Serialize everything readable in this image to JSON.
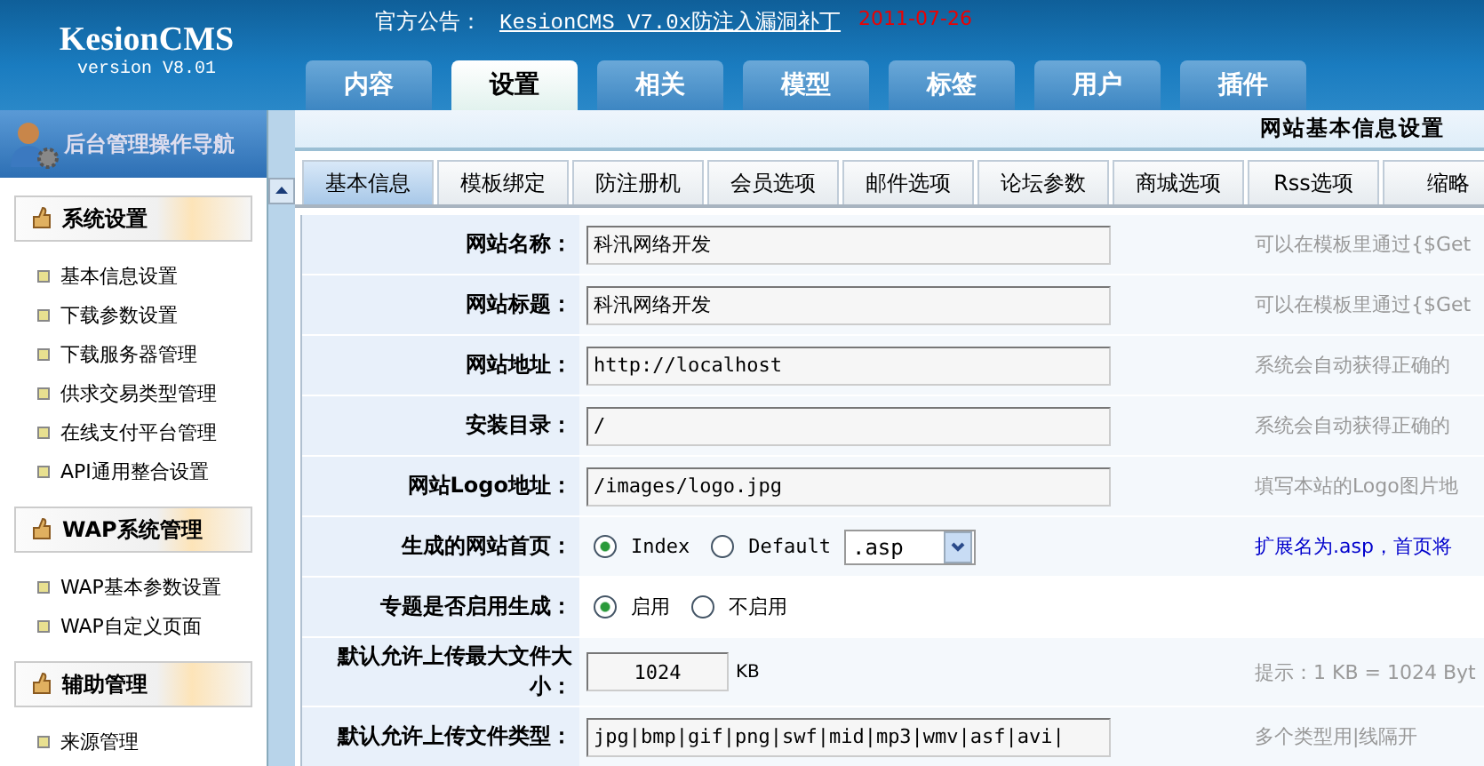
{
  "logo": {
    "name": "KesionCMS",
    "version": "version V8.01"
  },
  "notice": {
    "label": "官方公告：",
    "link": "KesionCMS V7.0x防注入漏洞补丁",
    "date": "2011-07-26"
  },
  "main_tabs": [
    {
      "label": "内容",
      "selected": false
    },
    {
      "label": "设置",
      "selected": true
    },
    {
      "label": "相关",
      "selected": false
    },
    {
      "label": "模型",
      "selected": false
    },
    {
      "label": "标签",
      "selected": false
    },
    {
      "label": "用户",
      "selected": false
    },
    {
      "label": "插件",
      "selected": false
    }
  ],
  "sidebar": {
    "title": "后台管理操作导航",
    "sections": [
      {
        "title": "系统设置",
        "items": [
          "基本信息设置",
          "下载参数设置",
          "下载服务器管理",
          "供求交易类型管理",
          "在线支付平台管理",
          "API通用整合设置"
        ]
      },
      {
        "title": "WAP系统管理",
        "items": [
          "WAP基本参数设置",
          "WAP自定义页面"
        ]
      },
      {
        "title": "辅助管理",
        "items": [
          "来源管理"
        ]
      }
    ]
  },
  "page_title": "网站基本信息设置",
  "sub_tabs": [
    {
      "label": "基本信息",
      "selected": true
    },
    {
      "label": "模板绑定",
      "selected": false
    },
    {
      "label": "防注册机",
      "selected": false
    },
    {
      "label": "会员选项",
      "selected": false
    },
    {
      "label": "邮件选项",
      "selected": false
    },
    {
      "label": "论坛参数",
      "selected": false
    },
    {
      "label": "商城选项",
      "selected": false
    },
    {
      "label": "Rss选项",
      "selected": false
    },
    {
      "label": "缩略",
      "selected": false
    }
  ],
  "form_rows": [
    {
      "kind": "text",
      "label": "网站名称：",
      "value": "科汛网络开发",
      "hint": "可以在模板里通过{$Get"
    },
    {
      "kind": "text",
      "label": "网站标题：",
      "value": "科汛网络开发",
      "hint": "可以在模板里通过{$Get"
    },
    {
      "kind": "text",
      "label": "网站地址：",
      "value": "http://localhost",
      "hint": "系统会自动获得正确的"
    },
    {
      "kind": "text",
      "label": "安装目录：",
      "value": "/",
      "hint": "系统会自动获得正确的"
    },
    {
      "kind": "text",
      "label": "网站Logo地址：",
      "value": "/images/logo.jpg",
      "hint": "填写本站的Logo图片地"
    },
    {
      "kind": "radio",
      "label": "生成的网站首页：",
      "options": [
        {
          "label": "Index",
          "selected": true
        },
        {
          "label": "Default",
          "selected": false
        }
      ],
      "select": ".asp",
      "hint": "扩展名为.asp，首页将",
      "hint_link": true
    },
    {
      "kind": "radio",
      "label": "专题是否启用生成：",
      "options": [
        {
          "label": "启用",
          "selected": true
        },
        {
          "label": "不启用",
          "selected": false
        }
      ]
    },
    {
      "kind": "number",
      "label": "默认允许上传最大文件大小：",
      "value": "1024",
      "unit": "KB",
      "hint": "提示：1 KB = 1024 Byt"
    },
    {
      "kind": "text",
      "label": "默认允许上传文件类型：",
      "value": "jpg|bmp|gif|png|swf|mid|mp3|wmv|asf|avi|",
      "hint": "多个类型用|线隔开"
    }
  ]
}
